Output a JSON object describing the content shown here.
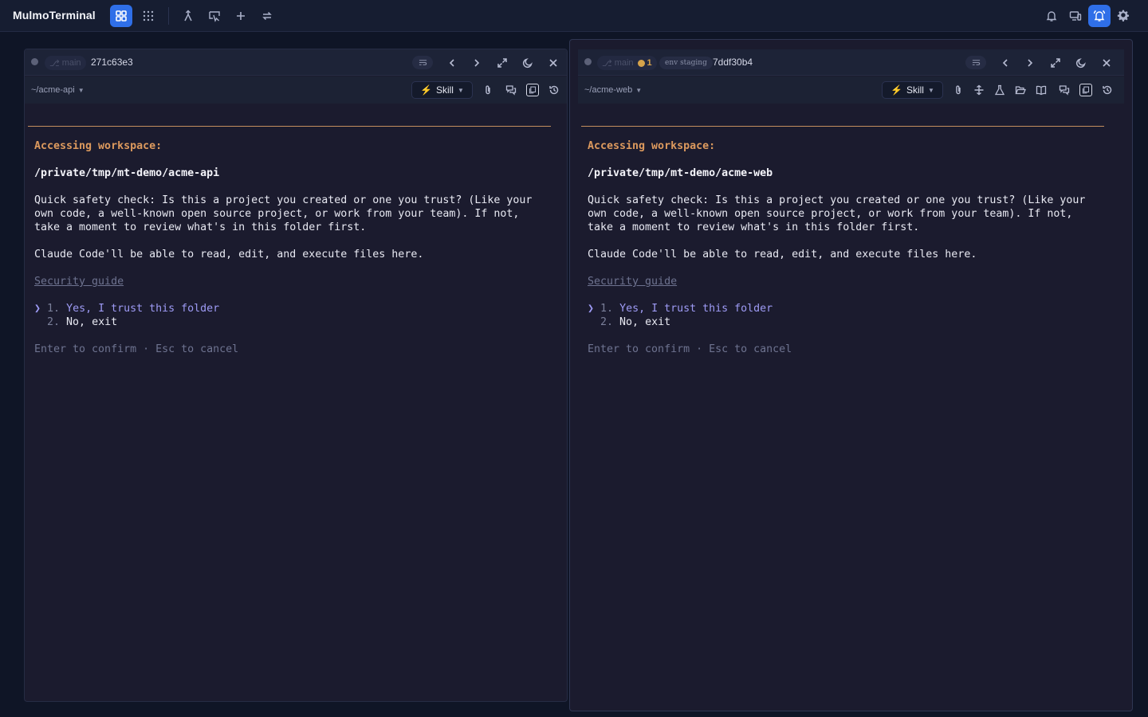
{
  "app": {
    "title": "MulmoTerminal"
  },
  "toolbar": {
    "left_icons": [
      "grid-layout-icon",
      "apps-grid-icon",
      "merge-icon",
      "pointer-off-icon",
      "plus-icon",
      "swap-icon"
    ],
    "right_icons": [
      "bell-icon",
      "devices-icon",
      "bell-ringing-icon",
      "settings-icon"
    ]
  },
  "panes": [
    {
      "branch": "main",
      "dirty_count": "",
      "env": "",
      "session_id": "271c63e3",
      "cwd": "~/acme-api",
      "skill_label": "Skill",
      "terminal": {
        "heading": "Accessing workspace:",
        "path": "/private/tmp/mt-demo/acme-api",
        "para1_line1": "Quick safety check: Is this a project you created or one you trust? (Like your",
        "para1_line2": "own code, a well-known open source project, or work from your team). If not,",
        "para1_line3": "take a moment to review what's in this folder first.",
        "para2": "Claude Code'll be able to read, edit, and execute files here.",
        "link": "Security guide",
        "cursor": "❯",
        "option1_num": "1.",
        "option1": "Yes, I trust this folder",
        "option2_num": "2.",
        "option2": "No, exit",
        "hint": "Enter to confirm · Esc to cancel"
      }
    },
    {
      "branch": "main",
      "dirty_count": "1",
      "env": "env staging",
      "session_id": "7ddf30b4",
      "cwd": "~/acme-web",
      "skill_label": "Skill",
      "terminal": {
        "heading": "Accessing workspace:",
        "path": "/private/tmp/mt-demo/acme-web",
        "para1_line1": "Quick safety check: Is this a project you created or one you trust? (Like your",
        "para1_line2": "own code, a well-known open source project, or work from your team). If not,",
        "para1_line3": "take a moment to review what's in this folder first.",
        "para2": "Claude Code'll be able to read, edit, and execute files here.",
        "link": "Security guide",
        "cursor": "❯",
        "option1_num": "1.",
        "option1": "Yes, I trust this folder",
        "option2_num": "2.",
        "option2": "No, exit",
        "hint": "Enter to confirm · Esc to cancel"
      }
    }
  ],
  "colors": {
    "accent": "#2f6fe8",
    "terminal_heading": "#dd9a5e",
    "selected_option": "#9e9bf5",
    "dirty_indicator": "#d6a34b"
  }
}
